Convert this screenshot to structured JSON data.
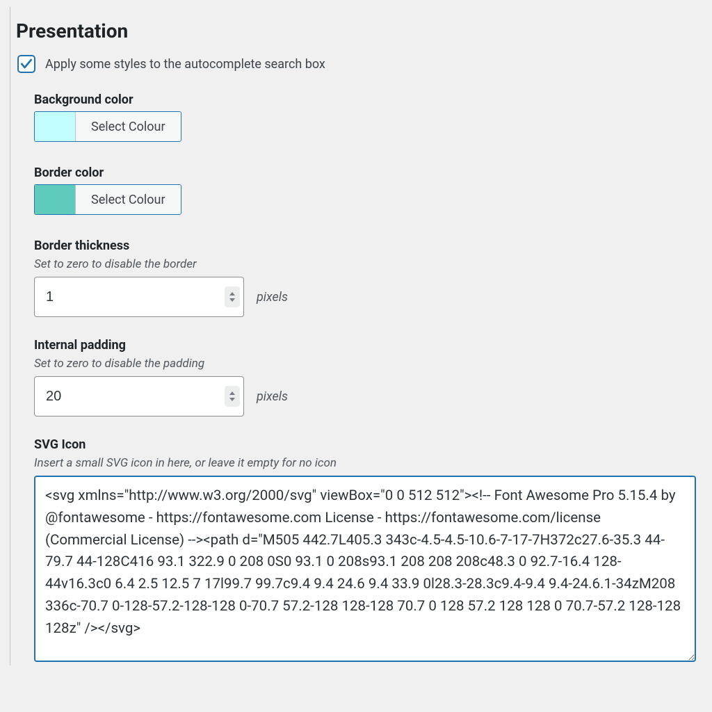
{
  "section": {
    "title": "Presentation"
  },
  "checkbox": {
    "label": "Apply some styles to the autocomplete search box",
    "checked": true
  },
  "fields": {
    "bg_color": {
      "label": "Background color",
      "button": "Select Colour",
      "value": "#c2fdff"
    },
    "border_color": {
      "label": "Border color",
      "button": "Select Colour",
      "value": "#5fcbbd"
    },
    "border_thickness": {
      "label": "Border thickness",
      "help": "Set to zero to disable the border",
      "value": "1",
      "unit": "pixels"
    },
    "internal_padding": {
      "label": "Internal padding",
      "help": "Set to zero to disable the padding",
      "value": "20",
      "unit": "pixels"
    },
    "svg_icon": {
      "label": "SVG Icon",
      "help": "Insert a small SVG icon in here, or leave it empty for no icon",
      "value": "<svg xmlns=\"http://www.w3.org/2000/svg\" viewBox=\"0 0 512 512\"><!-- Font Awesome Pro 5.15.4 by @fontawesome - https://fontawesome.com License - https://fontawesome.com/license (Commercial License) --><path d=\"M505 442.7L405.3 343c-4.5-4.5-10.6-7-17-7H372c27.6-35.3 44-79.7 44-128C416 93.1 322.9 0 208 0S0 93.1 0 208s93.1 208 208 208c48.3 0 92.7-16.4 128-44v16.3c0 6.4 2.5 12.5 7 17l99.7 99.7c9.4 9.4 24.6 9.4 33.9 0l28.3-28.3c9.4-9.4 9.4-24.6.1-34zM208 336c-70.7 0-128-57.2-128-128 0-70.7 57.2-128 128-128 70.7 0 128 57.2 128 128 0 70.7-57.2 128-128 128z\" /></svg>"
    }
  }
}
